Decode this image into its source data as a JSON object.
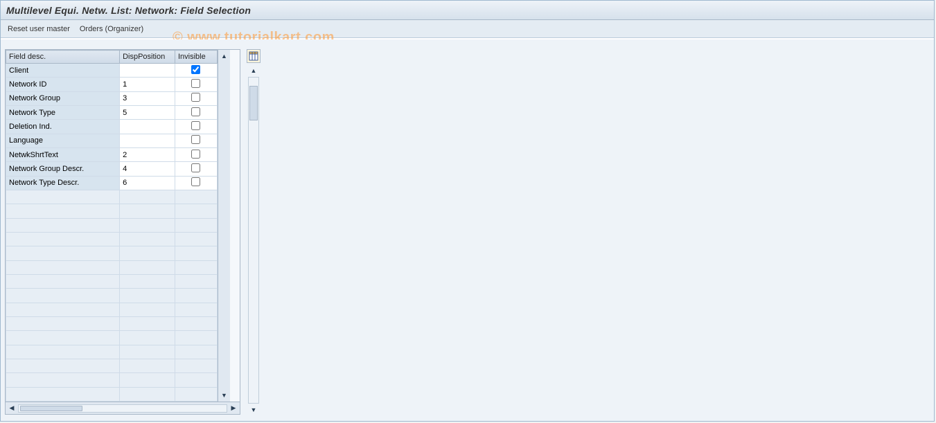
{
  "title": "Multilevel Equi. Netw. List: Network: Field Selection",
  "toolbar": {
    "reset_user_master": "Reset user master",
    "orders_organizer": "Orders (Organizer)"
  },
  "watermark": "© www.tutorialkart.com",
  "grid": {
    "headers": {
      "field_desc": "Field desc.",
      "disp_position": "DispPosition",
      "invisible": "Invisible"
    },
    "rows": [
      {
        "label": "Client",
        "pos": "",
        "invisible": true
      },
      {
        "label": "Network ID",
        "pos": "1",
        "invisible": false
      },
      {
        "label": "Network Group",
        "pos": "3",
        "invisible": false
      },
      {
        "label": "Network Type",
        "pos": "5",
        "invisible": false
      },
      {
        "label": "Deletion Ind.",
        "pos": "",
        "invisible": false
      },
      {
        "label": "Language",
        "pos": "",
        "invisible": false
      },
      {
        "label": "NetwkShrtText",
        "pos": "2",
        "invisible": false
      },
      {
        "label": "Network Group Descr.",
        "pos": "4",
        "invisible": false
      },
      {
        "label": "Network Type Descr.",
        "pos": "6",
        "invisible": false
      }
    ],
    "empty_rows": 15
  }
}
